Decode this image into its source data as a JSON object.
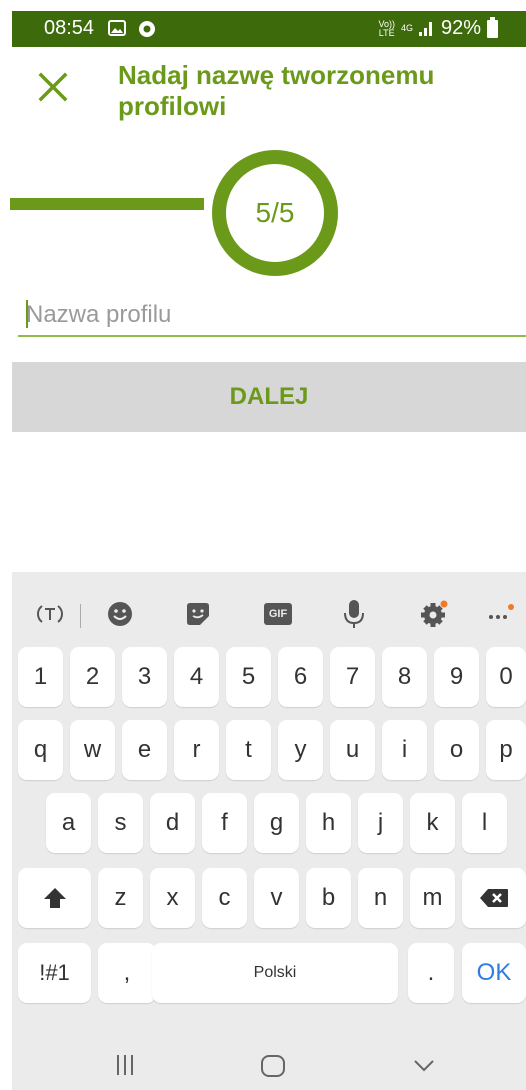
{
  "status_bar": {
    "time": "08:54",
    "network_top": "Vo))",
    "network_bottom": "LTE",
    "gen": "4G",
    "battery": "92%"
  },
  "header": {
    "title": "Nadaj nazwę tworzonemu profilowi"
  },
  "progress": {
    "label": "5/5",
    "current": 5,
    "total": 5
  },
  "form": {
    "placeholder": "Nazwa profilu",
    "value": ""
  },
  "next_button": {
    "label": "DALEJ"
  },
  "keyboard": {
    "toolbar_gif": "GIF",
    "numbers": [
      "1",
      "2",
      "3",
      "4",
      "5",
      "6",
      "7",
      "8",
      "9",
      "0"
    ],
    "row1": [
      "q",
      "w",
      "e",
      "r",
      "t",
      "y",
      "u",
      "i",
      "o",
      "p"
    ],
    "row2": [
      "a",
      "s",
      "d",
      "f",
      "g",
      "h",
      "j",
      "k",
      "l"
    ],
    "row3": [
      "z",
      "x",
      "c",
      "v",
      "b",
      "n",
      "m"
    ],
    "symbols_key": "!#1",
    "comma_key": ",",
    "space_key": "Polski",
    "period_key": ".",
    "ok_key": "OK"
  },
  "colors": {
    "brand": "#6b9a1a",
    "status_bar": "#3d6b0c",
    "keyboard_bg": "#ebebeb",
    "ok": "#2e7de0"
  }
}
